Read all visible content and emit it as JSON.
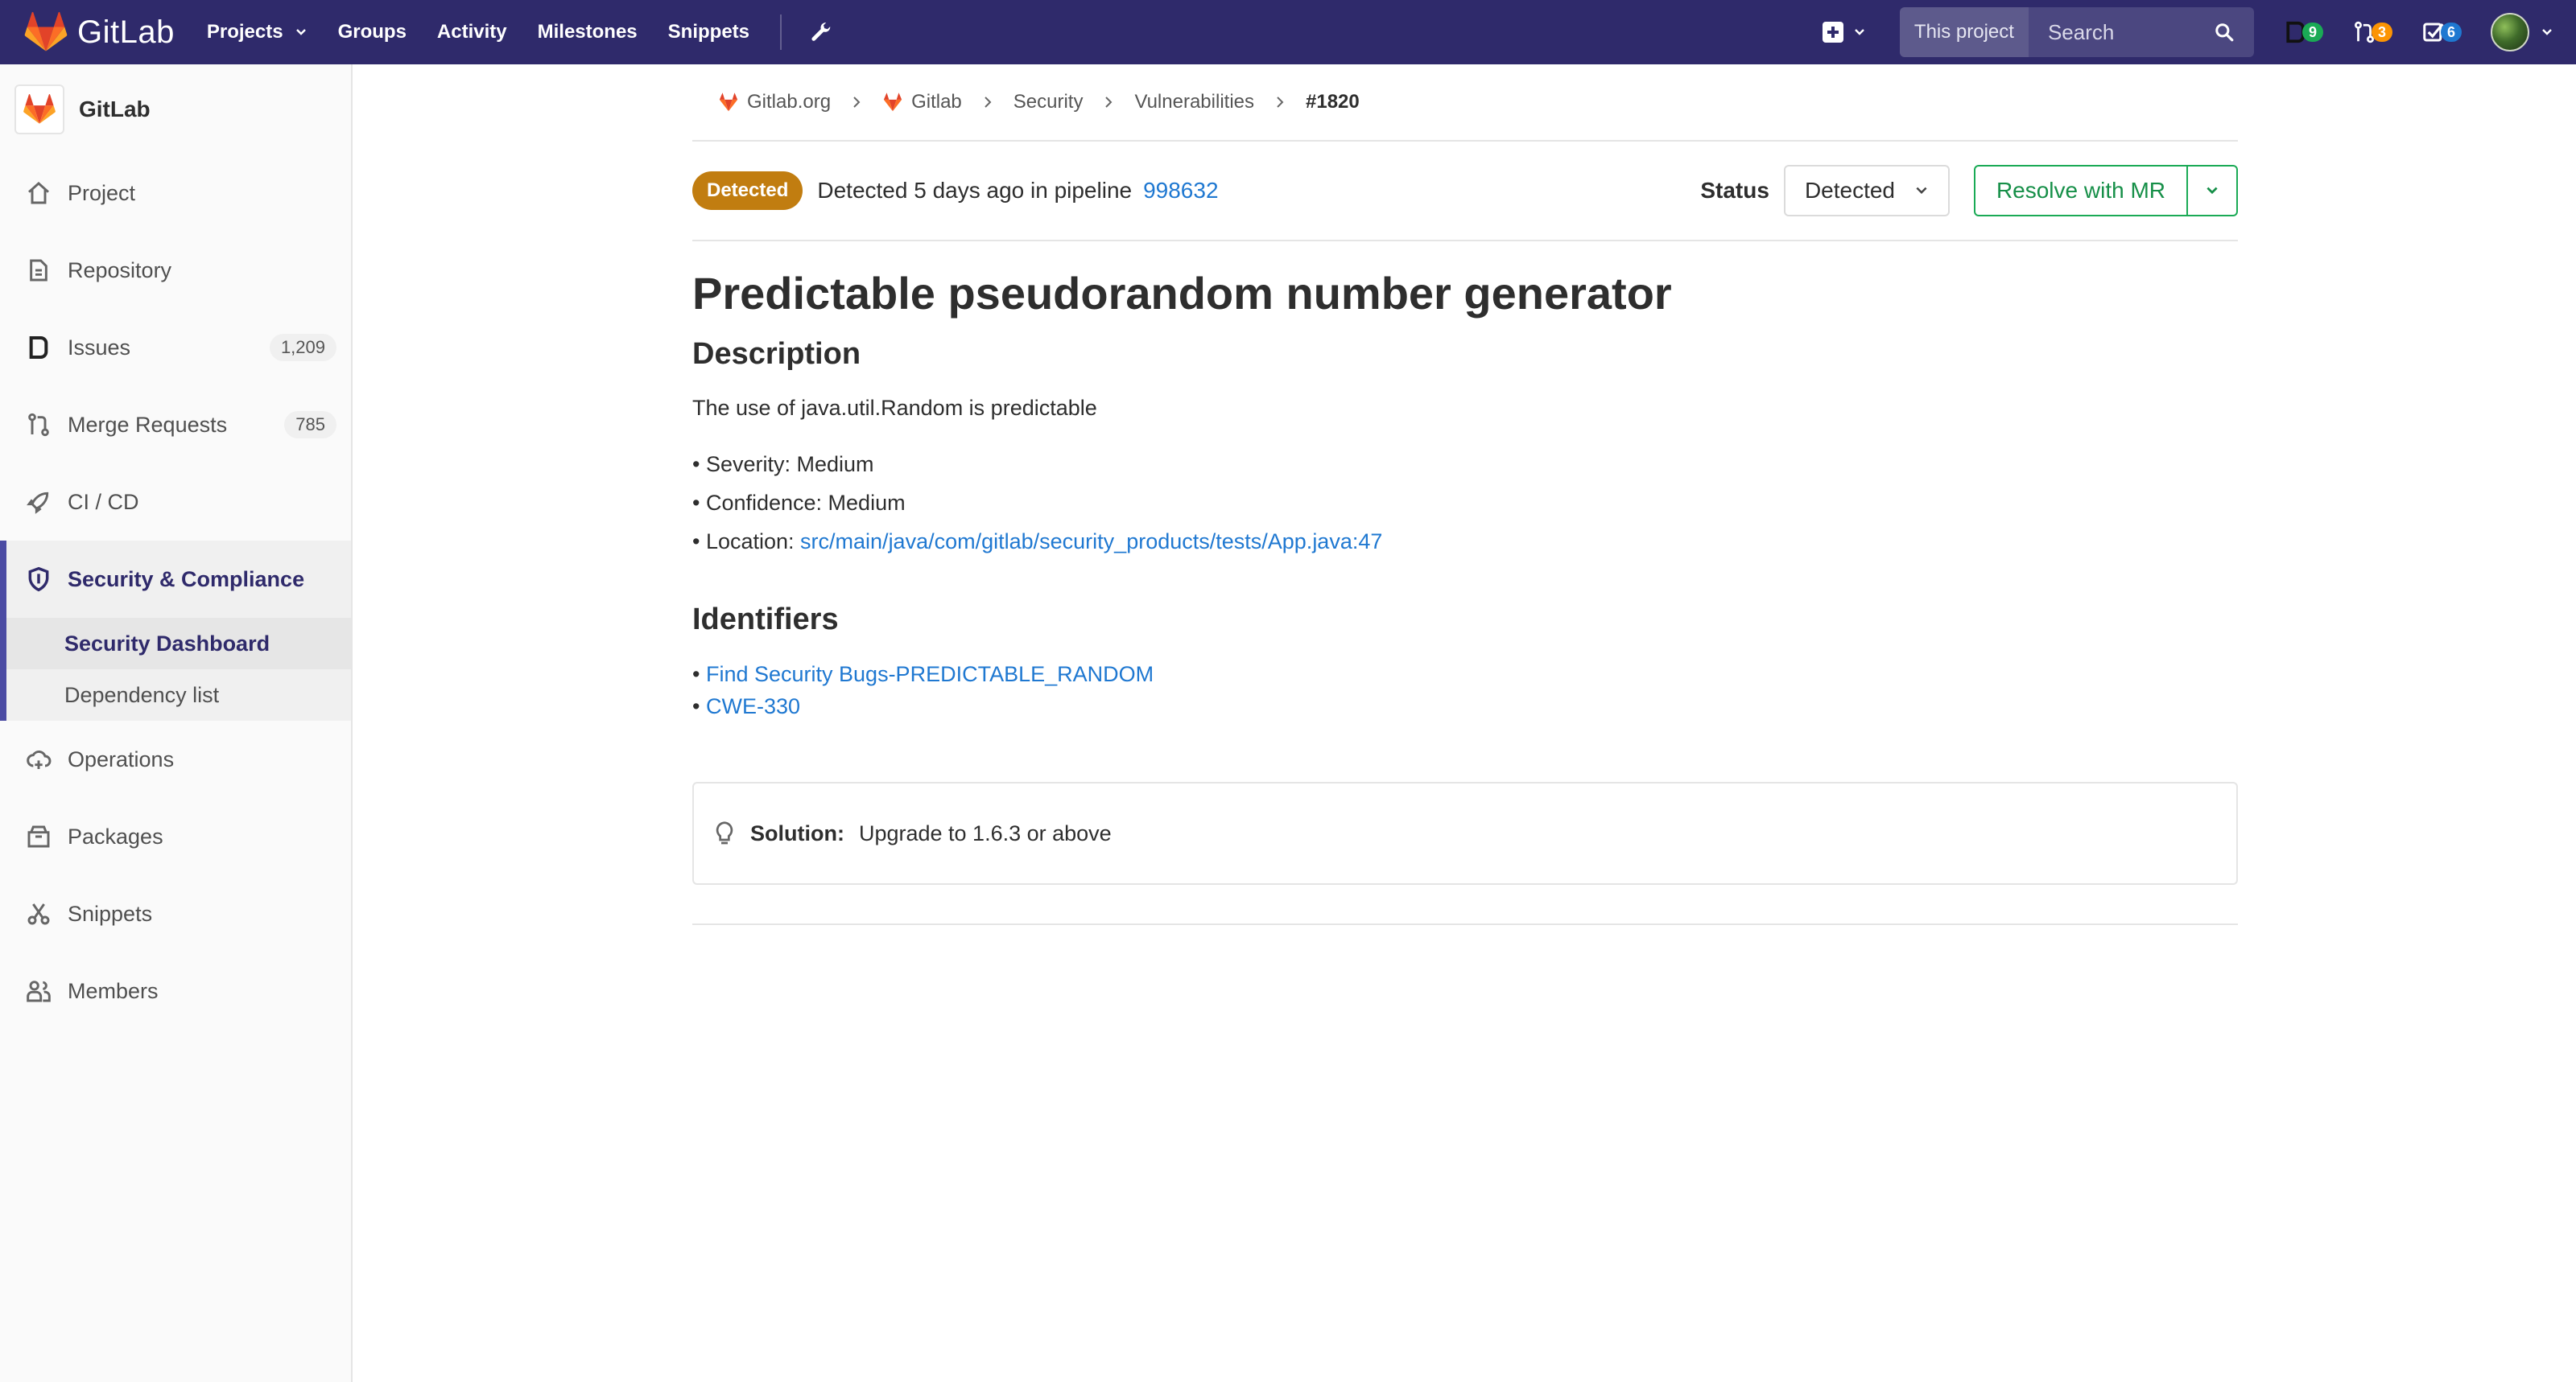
{
  "navbar": {
    "brand": "GitLab",
    "links": [
      "Projects",
      "Groups",
      "Activity",
      "Milestones",
      "Snippets"
    ],
    "search_scope": "This project",
    "search_placeholder": "Search",
    "counters": {
      "issues": "9",
      "merge_requests": "3",
      "todos": "6"
    },
    "colors": {
      "background": "#2f2a6b",
      "issues_badge": "#1aaa55",
      "mr_badge": "#fc9403",
      "todos_badge": "#1f78d1"
    }
  },
  "sidebar": {
    "project_name": "GitLab",
    "items": [
      {
        "label": "Project",
        "icon": "home-icon"
      },
      {
        "label": "Repository",
        "icon": "doc-icon"
      },
      {
        "label": "Issues",
        "icon": "issues-icon",
        "count": "1,209"
      },
      {
        "label": "Merge Requests",
        "icon": "git-merge-icon",
        "count": "785"
      },
      {
        "label": "CI / CD",
        "icon": "rocket-icon"
      },
      {
        "label": "Security & Compliance",
        "icon": "shield-icon"
      },
      {
        "label": "Operations",
        "icon": "cloud-gear-icon"
      },
      {
        "label": "Packages",
        "icon": "package-icon"
      },
      {
        "label": "Snippets",
        "icon": "scissors-icon"
      },
      {
        "label": "Members",
        "icon": "users-icon"
      }
    ],
    "security_sub": [
      "Security Dashboard",
      "Dependency list"
    ]
  },
  "breadcrumbs": [
    "Gitlab.org",
    "Gitlab",
    "Security",
    "Vulnerabilities",
    "#1820"
  ],
  "vulnerability": {
    "state_badge": "Detected",
    "detected_text": "Detected 5 days ago in pipeline",
    "pipeline_id": "998632",
    "status_label": "Status",
    "status_value": "Detected",
    "resolve_button": "Resolve with MR",
    "title": "Predictable pseudorandom number generator",
    "description_heading": "Description",
    "description": "The use of java.util.Random is predictable",
    "severity": "• Severity: Medium",
    "confidence": "• Confidence: Medium",
    "location_label": "• Location: ",
    "location_link": "src/main/java/com/gitlab/security_products/tests/App.java:47",
    "identifiers_heading": "Identifiers",
    "identifiers": [
      "Find Security Bugs-PREDICTABLE_RANDOM",
      "CWE-330"
    ],
    "solution_label": "Solution:",
    "solution_text": "Upgrade to 1.6.3 or above",
    "badge_color": "#c17d10"
  }
}
